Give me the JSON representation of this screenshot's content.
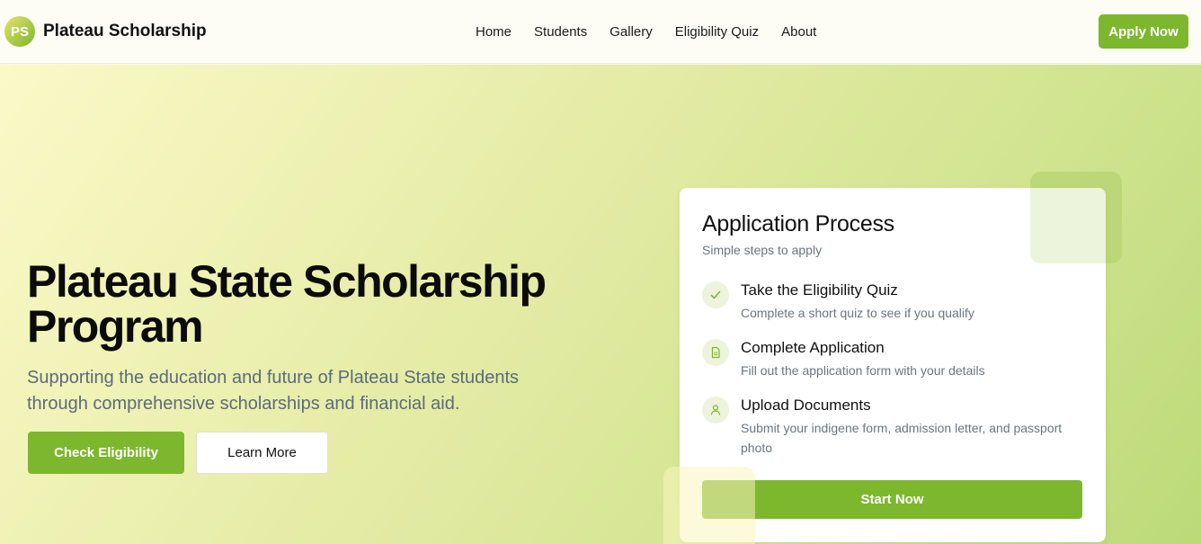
{
  "header": {
    "logo_initials": "PS",
    "brand": "Plateau Scholarship",
    "nav": [
      "Home",
      "Students",
      "Gallery",
      "Eligibility Quiz",
      "About"
    ],
    "apply_label": "Apply Now"
  },
  "hero": {
    "title": "Plateau State Scholarship Program",
    "subtitle": "Supporting the education and future of Plateau State students through comprehensive scholarships and financial aid.",
    "primary_button": "Check Eligibility",
    "secondary_button": "Learn More"
  },
  "card": {
    "title": "Application Process",
    "subtitle": "Simple steps to apply",
    "steps": [
      {
        "icon": "check-icon",
        "title": "Take the Eligibility Quiz",
        "desc": "Complete a short quiz to see if you qualify"
      },
      {
        "icon": "document-icon",
        "title": "Complete Application",
        "desc": "Fill out the application form with your details"
      },
      {
        "icon": "user-icon",
        "title": "Upload Documents",
        "desc": "Submit your indigene form, admission letter, and passport photo"
      }
    ],
    "start_label": "Start Now"
  },
  "colors": {
    "accent": "#7db72e",
    "muted_text": "#6b7580"
  }
}
